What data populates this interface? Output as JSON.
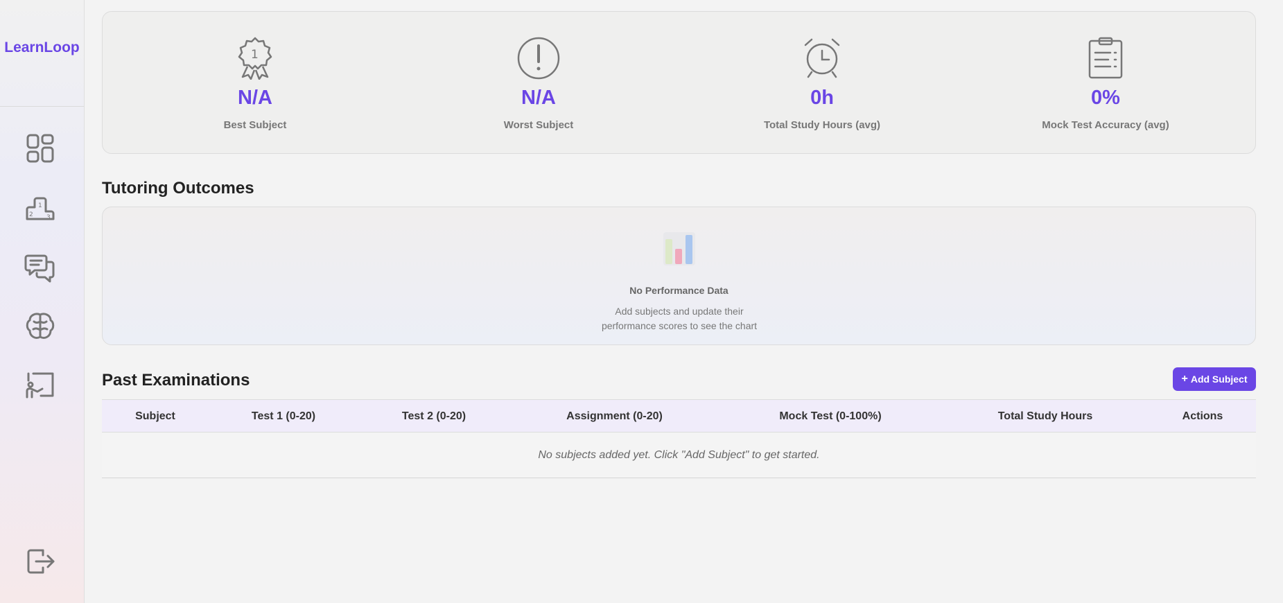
{
  "sidebar": {
    "brand": "LearnLoop",
    "items": [
      {
        "icon": "dashboard-icon"
      },
      {
        "icon": "podium-icon"
      },
      {
        "icon": "chat-icon"
      },
      {
        "icon": "brain-icon"
      },
      {
        "icon": "teacher-board-icon"
      }
    ],
    "logout_icon": "logout-icon"
  },
  "stats": [
    {
      "icon": "award-badge-icon",
      "value": "N/A",
      "label": "Best Subject"
    },
    {
      "icon": "alert-circle-icon",
      "value": "N/A",
      "label": "Worst Subject"
    },
    {
      "icon": "alarm-clock-icon",
      "value": "0h",
      "label": "Total Study Hours (avg)"
    },
    {
      "icon": "clipboard-list-icon",
      "value": "0%",
      "label": "Mock Test Accuracy (avg)"
    }
  ],
  "outcomes": {
    "title": "Tutoring Outcomes",
    "empty_title": "No Performance Data",
    "empty_desc_line1": "Add subjects and update their",
    "empty_desc_line2": "performance scores to see the chart"
  },
  "exams": {
    "title": "Past Examinations",
    "add_button": "Add Subject",
    "columns": [
      "Subject",
      "Test 1 (0-20)",
      "Test 2 (0-20)",
      "Assignment (0-20)",
      "Mock Test (0-100%)",
      "Total Study Hours",
      "Actions"
    ],
    "empty_message": "No subjects added yet. Click \"Add Subject\" to get started."
  },
  "colors": {
    "accent": "#6a46e5",
    "icon_gray": "#777777"
  }
}
